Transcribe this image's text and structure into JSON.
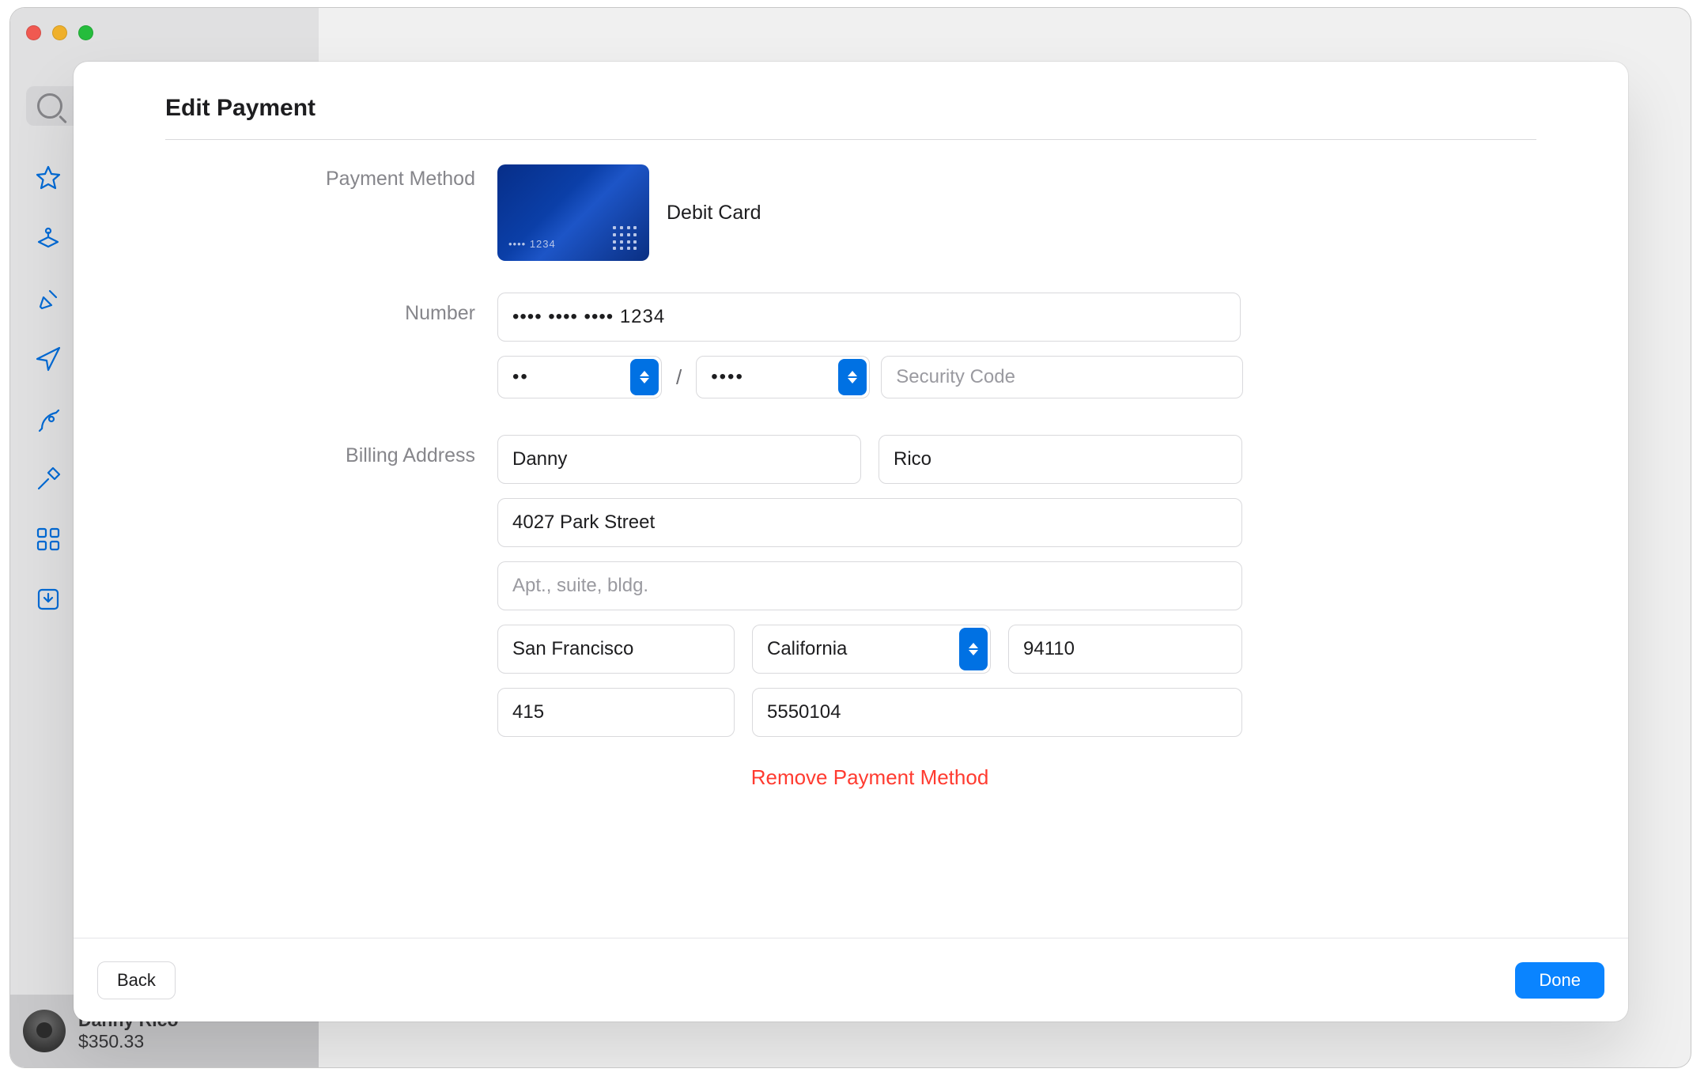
{
  "window": {
    "sidebar": {
      "user_name": "Danny Rico",
      "user_balance": "$350.33"
    }
  },
  "sheet": {
    "title": "Edit Payment",
    "labels": {
      "payment_method": "Payment Method",
      "number": "Number",
      "billing_address": "Billing Address"
    },
    "payment_method": {
      "type_label": "Debit Card",
      "card_last_digits": "•••• 1234"
    },
    "number_field": "•••• •••• •••• 1234",
    "exp_month": "••",
    "exp_year": "••••",
    "security_placeholder": "Security Code",
    "billing": {
      "first_name": "Danny",
      "last_name": "Rico",
      "street": "4027 Park Street",
      "apt_placeholder": "Apt., suite, bldg.",
      "city": "San Francisco",
      "state": "California",
      "zip": "94110",
      "area_code": "415",
      "phone": "5550104"
    },
    "remove_link": "Remove Payment Method",
    "buttons": {
      "back": "Back",
      "done": "Done"
    }
  }
}
